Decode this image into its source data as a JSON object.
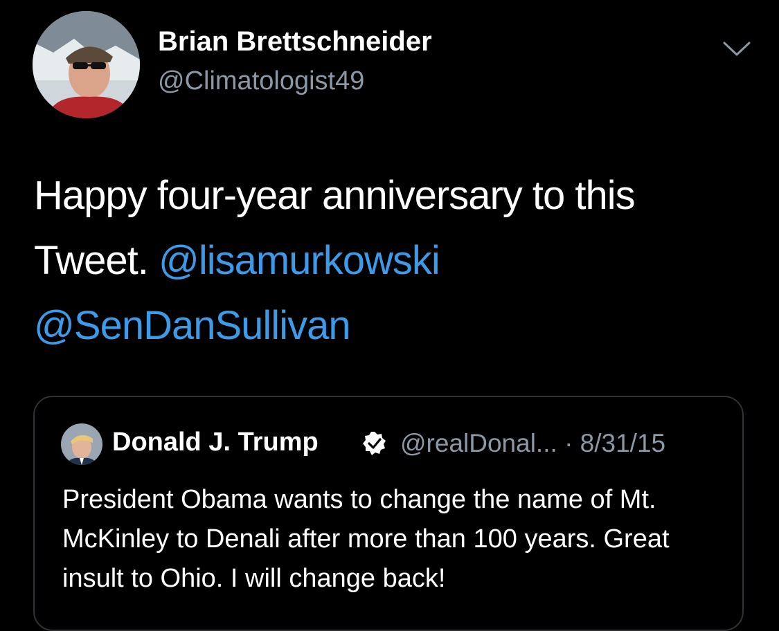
{
  "tweet": {
    "author": {
      "display_name": "Brian Brettschneider",
      "handle": "@Climatologist49",
      "avatar": "user-avatar-photo"
    },
    "menu_icon": "chevron-down-icon",
    "text_lines": {
      "line1": "Happy four-year anniversary to this",
      "line2_prefix": "Tweet. ",
      "mention1": "@lisamurkowski",
      "mention2": "@SenDanSullivan"
    }
  },
  "quoted_tweet": {
    "author": {
      "display_name": "Donald J. Trump",
      "verified_icon": "verified-badge-icon",
      "handle": "@realDonal...",
      "separator": "·",
      "date": "8/31/15"
    },
    "text": "President Obama wants to change the name of Mt. McKinley to Denali after more than 100 years. Great insult to Ohio. I will change back!"
  },
  "colors": {
    "background": "#000000",
    "primary_text": "#ffffff",
    "secondary_text": "#8b98a5",
    "link": "#3d9ae8",
    "border": "#2f3336"
  }
}
